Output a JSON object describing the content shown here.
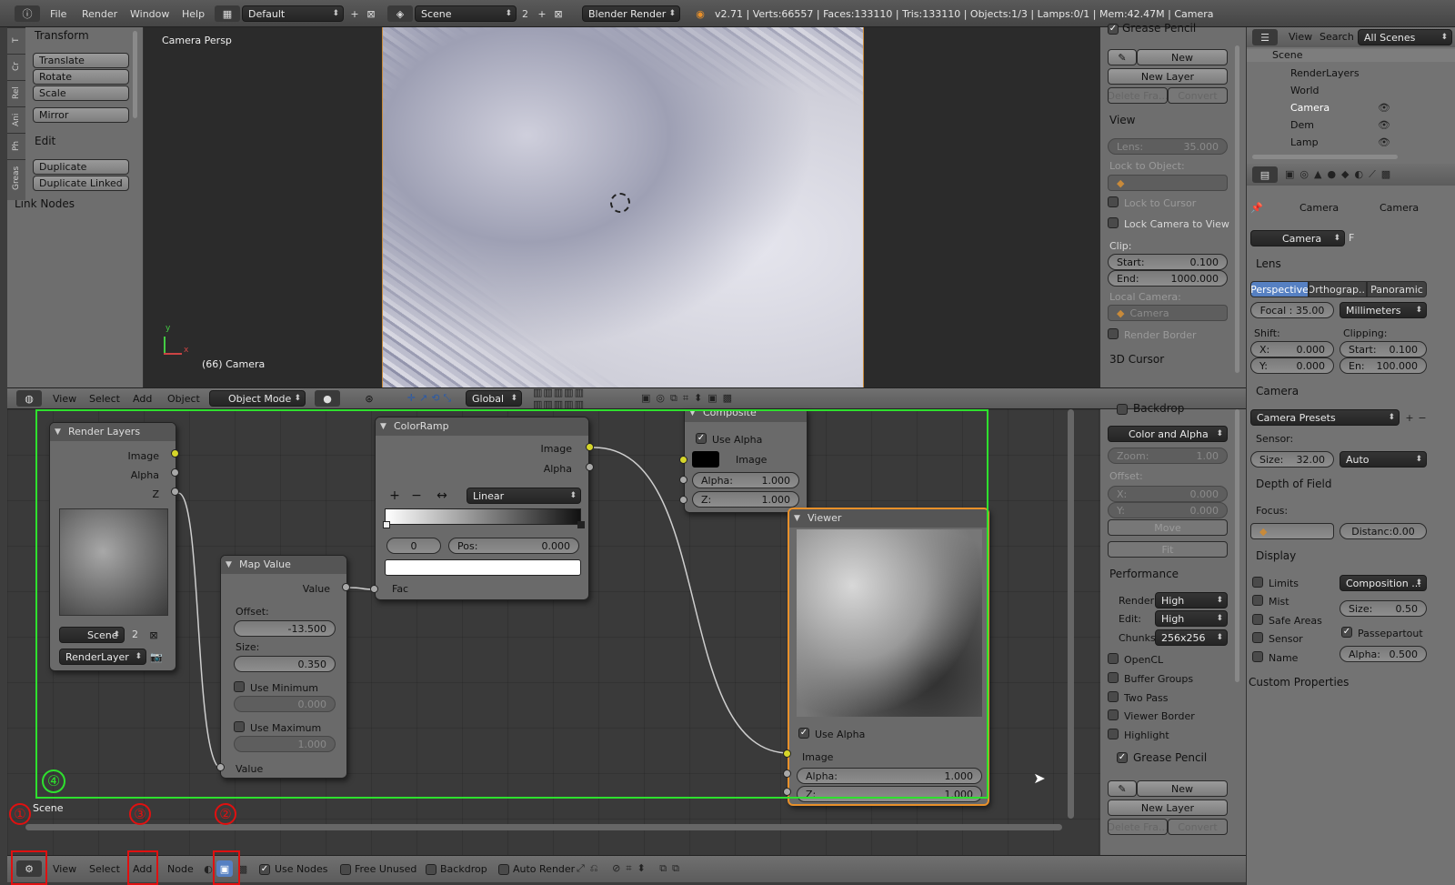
{
  "topbar": {
    "menus": [
      "File",
      "Render",
      "Window",
      "Help"
    ],
    "layout": "Default",
    "scene": "Scene",
    "scene_num": "2",
    "engine": "Blender Render",
    "stats": "v2.71 | Verts:66557 | Faces:133110 | Tris:133110 | Objects:1/3 | Lamps:0/1 | Mem:42.47M | Camera"
  },
  "toolshelf": {
    "tabs": [
      "T",
      "Cr",
      "Rel",
      "Ani",
      "Ph",
      "Greas"
    ],
    "transform_header": "Transform",
    "translate": "Translate",
    "rotate": "Rotate",
    "scale": "Scale",
    "mirror": "Mirror",
    "edit_header": "Edit",
    "duplicate": "Duplicate",
    "duplicate_linked": "Duplicate Linked",
    "link_nodes": "Link Nodes"
  },
  "viewport": {
    "title": "Camera Persp",
    "camera_label": "(66) Camera",
    "axis_y": "y",
    "axis_x": "x"
  },
  "npanel": {
    "grease_pencil": "Grease Pencil",
    "new": "New",
    "new_layer": "New Layer",
    "delete_frame": "Delete Fra...",
    "convert": "Convert",
    "view_header": "View",
    "lens_label": "Lens:",
    "lens_value": "35.000",
    "lock_to_object": "Lock to Object:",
    "lock_to_cursor": "Lock to Cursor",
    "lock_camera": "Lock Camera to View",
    "clip": "Clip:",
    "clip_start_label": "Start:",
    "clip_start": "0.100",
    "clip_end_label": "End:",
    "clip_end": "1000.000",
    "local_camera": "Local Camera:",
    "local_camera_val": "Camera",
    "render_border": "Render Border",
    "cursor_header": "3D Cursor"
  },
  "outliner": {
    "menus": [
      "View",
      "Search"
    ],
    "filter": "All Scenes",
    "items": [
      "Scene",
      "RenderLayers",
      "World",
      "Camera",
      "Dem",
      "Lamp"
    ]
  },
  "props": {
    "breadcrumb1": "Camera",
    "breadcrumb2": "Camera",
    "datablock": "Camera",
    "datablock_f": "F",
    "lens_header": "Lens",
    "tabs": [
      "Perspective",
      "Orthograp...",
      "Panoramic"
    ],
    "focal": "Focal : 35.00",
    "units": "Millimeters",
    "shift": "Shift:",
    "clipping": "Clipping:",
    "shift_x": "X:",
    "shift_x_val": "0.000",
    "shift_y": "Y:",
    "shift_y_val": "0.000",
    "clip_start": "Start:",
    "clip_start_val": "0.100",
    "clip_end": "En:",
    "clip_end_val": "100.000",
    "camera_header": "Camera",
    "camera_presets": "Camera Presets",
    "sensor": "Sensor:",
    "sensor_size": "Size:",
    "sensor_size_val": "32.00",
    "sensor_fit": "Auto",
    "dof_header": "Depth of Field",
    "focus": "Focus:",
    "distance": "Distanc:0.00",
    "display_header": "Display",
    "limits": "Limits",
    "composition": "Composition ...",
    "mist": "Mist",
    "size_label": "Size:",
    "size_val": "0.50",
    "safe_areas": "Safe Areas",
    "passepartout": "Passepartout",
    "sensor_chk": "Sensor",
    "alpha_label": "Alpha:",
    "alpha_val": "0.500",
    "name_chk": "Name",
    "custom_props": "Custom Properties"
  },
  "vphdr": {
    "menus": [
      "View",
      "Select",
      "Add",
      "Object"
    ],
    "mode": "Object Mode",
    "orientation": "Global"
  },
  "nodes": {
    "render_layers": {
      "title": "Render Layers",
      "image": "Image",
      "alpha": "Alpha",
      "z": "Z",
      "scene": "Scene",
      "scene_num": "2",
      "layer": "RenderLayer"
    },
    "map_value": {
      "title": "Map Value",
      "value_out": "Value",
      "offset": "Offset:",
      "offset_val": "-13.500",
      "size": "Size:",
      "size_val": "0.350",
      "use_min": "Use Minimum",
      "min_val": "0.000",
      "use_max": "Use Maximum",
      "max_val": "1.000",
      "value_in": "Value"
    },
    "color_ramp": {
      "title": "ColorRamp",
      "image": "Image",
      "alpha": "Alpha",
      "interp": "Linear",
      "index": "0",
      "pos_label": "Pos:",
      "pos_val": "0.000",
      "fac": "Fac"
    },
    "composite": {
      "title": "Composite",
      "use_alpha": "Use Alpha",
      "image": "Image",
      "alpha_label": "Alpha:",
      "alpha_val": "1.000",
      "z_label": "Z:",
      "z_val": "1.000"
    },
    "viewer": {
      "title": "Viewer",
      "use_alpha": "Use Alpha",
      "image": "Image",
      "alpha_label": "Alpha:",
      "alpha_val": "1.000",
      "z_label": "Z:",
      "z_val": "1.000"
    },
    "scene_label": "Scene"
  },
  "npanel2": {
    "backdrop": "Backdrop",
    "color_alpha": "Color and Alpha",
    "zoom_label": "Zoom:",
    "zoom_val": "1.00",
    "offset": "Offset:",
    "x_label": "X:",
    "x_val": "0.000",
    "y_label": "Y:",
    "y_val": "0.000",
    "move": "Move",
    "fit": "Fit",
    "performance": "Performance",
    "render_label": "Render:",
    "render_val": "High",
    "edit_label": "Edit:",
    "edit_val": "High",
    "chunks_label": "Chunks",
    "chunks_val": "256x256",
    "opencl": "OpenCL",
    "buffer_groups": "Buffer Groups",
    "two_pass": "Two Pass",
    "viewer_border": "Viewer Border",
    "highlight": "Highlight",
    "grease_pencil": "Grease Pencil",
    "new": "New",
    "new_layer": "New Layer",
    "delete_frame": "Delete Fra...",
    "convert": "Convert"
  },
  "nodehdr": {
    "menus": [
      "View",
      "Select",
      "Add",
      "Node"
    ],
    "use_nodes": "Use Nodes",
    "free_unused": "Free Unused",
    "backdrop": "Backdrop",
    "auto_render": "Auto Render"
  },
  "annotations": {
    "a1": "①",
    "a2": "②",
    "a3": "③",
    "a4": "④"
  }
}
